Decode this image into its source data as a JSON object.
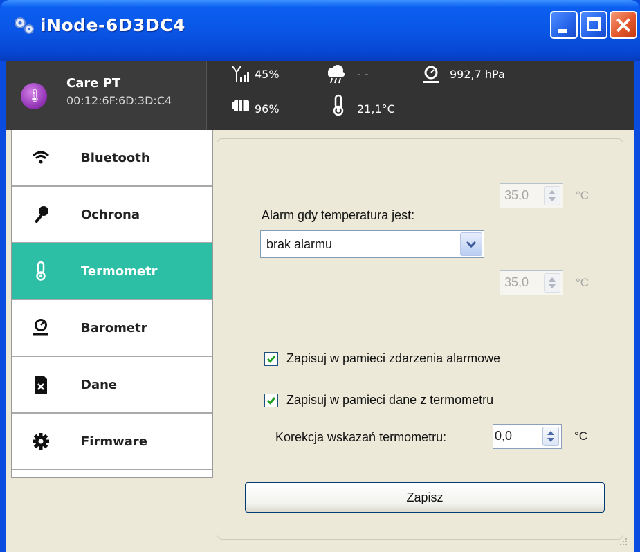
{
  "window": {
    "title": "iNode-6D3DC4",
    "controls": {
      "minimize": "minimize",
      "maximize": "maximize",
      "close": "close"
    }
  },
  "device": {
    "name": "Care PT",
    "mac": "00:12:6F:6D:3D:C4",
    "avatar_icon": "thermometer-badge-icon",
    "avatar_color": "#9a3bbf"
  },
  "status": {
    "signal": "45%",
    "rain": "- -",
    "pressure": "992,7 hPa",
    "battery": "96%",
    "temperature": "21,1°C"
  },
  "sidebar": {
    "active_color": "#2dbfa5",
    "items": [
      {
        "label": "Bluetooth",
        "icon": "wifi-icon",
        "active": false
      },
      {
        "label": "Ochrona",
        "icon": "key-icon",
        "active": false
      },
      {
        "label": "Termometr",
        "icon": "thermometer-icon",
        "active": true
      },
      {
        "label": "Barometr",
        "icon": "barometer-icon",
        "active": false
      },
      {
        "label": "Dane",
        "icon": "data-file-icon",
        "active": false
      },
      {
        "label": "Firmware",
        "icon": "gear-icon",
        "active": false
      }
    ]
  },
  "termometr": {
    "upper_limit": {
      "value": "35,0",
      "unit": "°C",
      "enabled": false
    },
    "alarm_label": "Alarm gdy temperatura jest:",
    "alarm_select": {
      "value": "brak alarmu"
    },
    "lower_limit": {
      "value": "35,0",
      "unit": "°C",
      "enabled": false
    },
    "save_alarm_events": {
      "label": "Zapisuj w pamieci zdarzenia alarmowe",
      "checked": true
    },
    "save_thermo_data": {
      "label": "Zapisuj w pamieci dane z termometru",
      "checked": true
    },
    "correction": {
      "label": "Korekcja wskazań  termometru:",
      "value": "0,0",
      "unit": "°C"
    },
    "save_button": "Zapisz"
  }
}
